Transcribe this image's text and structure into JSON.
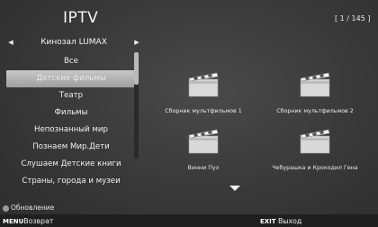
{
  "header": {
    "title": "IPTV",
    "counter": "[ 1 / 145 ]"
  },
  "category": {
    "prev_icon": "triangle-left-icon",
    "label": "Кинозал LUMAX",
    "next_icon": "triangle-right-icon"
  },
  "menu": {
    "items": [
      "Все",
      "Детские фильмы",
      "Театр",
      "Фильмы",
      "Непознанный мир",
      "Познаем Мир.Дети",
      "Слушаем Детские книги",
      "Страны, города и музеи"
    ],
    "selected_index": 1,
    "scroll_position": 0.0
  },
  "grid": {
    "items": [
      {
        "title": "Сборник мультфильмов 1",
        "icon": "clapperboard-icon"
      },
      {
        "title": "Сборник мультфильмов 2",
        "icon": "clapperboard-icon"
      },
      {
        "title": "Винни Пух",
        "icon": "clapperboard-icon"
      },
      {
        "title": "Чебурашка и Крокодил Гена",
        "icon": "clapperboard-icon"
      }
    ],
    "more_icon": "triangle-down-icon"
  },
  "footer": {
    "refresh_label": "Обновление",
    "back_key": "MENU",
    "back_label": "Возврат",
    "exit_key": "EXIT",
    "exit_label": "Выход"
  },
  "colors": {
    "background": "#3a3a3a",
    "highlight": "#b4b4b4",
    "footer_bar": "#1f1f1f"
  }
}
